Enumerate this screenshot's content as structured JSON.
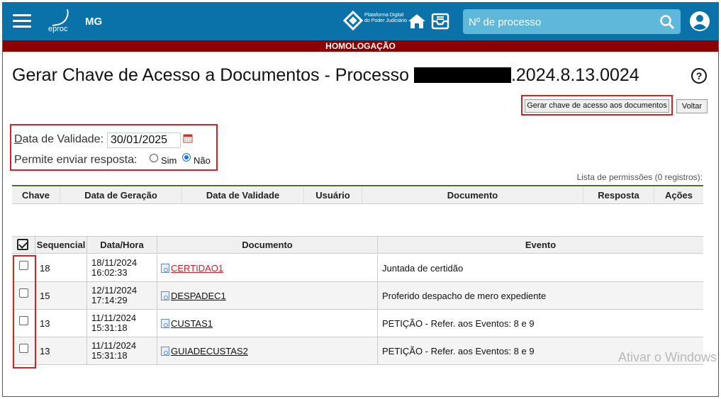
{
  "header": {
    "app_name": "eproc",
    "user_initials": "MG",
    "platform_label": "Plataforma Digital do Poder Judiciário",
    "search_placeholder": "Nº de processo",
    "environment_banner": "HOMOLOGAÇÃO"
  },
  "page": {
    "title_prefix": "Gerar Chave de Acesso a Documentos - Processo",
    "title_suffix": ".2024.8.13.0024",
    "help_label": "?",
    "generate_button": "Gerar chave de acesso aos documentos",
    "back_button": "Voltar"
  },
  "form": {
    "validity_label_first": "D",
    "validity_label_rest": "ata de Validade:",
    "validity_value": "30/01/2025",
    "allow_reply_label": "Permite enviar resposta:",
    "option_yes": "Sim",
    "option_no": "Não",
    "selected": "Não"
  },
  "permissions": {
    "caption": "Lista de permissões (0 registros):",
    "columns": [
      "Chave",
      "Data de Geração",
      "Data de Validade",
      "Usuário",
      "Documento",
      "Resposta",
      "Ações"
    ]
  },
  "documents": {
    "columns": [
      "Sequencial",
      "Data/Hora",
      "Documento",
      "Evento"
    ],
    "rows": [
      {
        "seq": "18",
        "date": "18/11/2024",
        "time": "16:02:33",
        "doc": "CERTIDAO1",
        "event": "Juntada de certidão"
      },
      {
        "seq": "15",
        "date": "12/11/2024",
        "time": "17:14:29",
        "doc": "DESPADEC1",
        "event": "Proferido despacho de mero expediente"
      },
      {
        "seq": "13",
        "date": "11/11/2024",
        "time": "15:31:18",
        "doc": "CUSTAS1",
        "event": "PETIÇÃO - Refer. aos Eventos: 8 e 9"
      },
      {
        "seq": "13",
        "date": "11/11/2024",
        "time": "15:31:18",
        "doc": "GUIADECUSTAS2",
        "event": "PETIÇÃO - Refer. aos Eventos: 8 e 9"
      }
    ]
  },
  "watermark": "Ativar o Windows",
  "colors": {
    "header_bg": "#0a72a8",
    "banner_bg": "#8b0000",
    "highlight_outline": "#d61f26",
    "link_red": "#d61f26"
  }
}
